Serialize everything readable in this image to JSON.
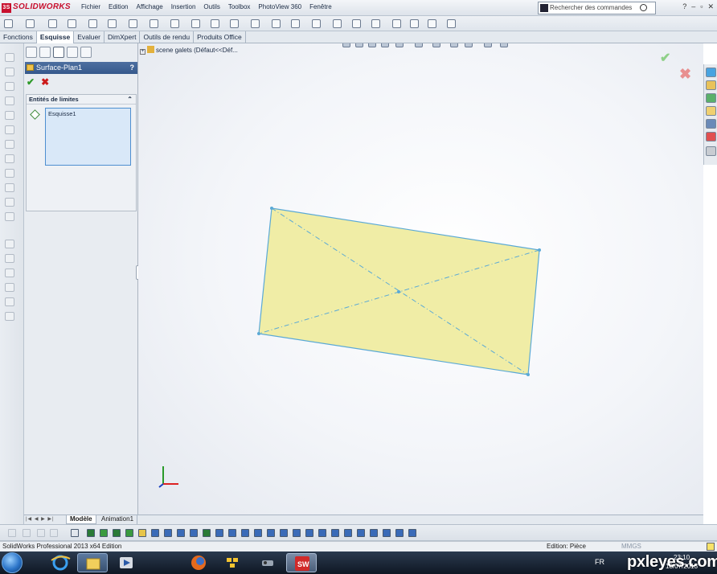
{
  "app": {
    "name": "SOLIDWORKS"
  },
  "menu": {
    "items": [
      "Fichier",
      "Edition",
      "Affichage",
      "Insertion",
      "Outils",
      "Toolbox",
      "PhotoView 360",
      "Fenêtre"
    ]
  },
  "search": {
    "placeholder": "Rechercher des commandes"
  },
  "command_tabs": [
    "Fonctions",
    "Esquisse",
    "Evaluer",
    "DimXpert",
    "Outils de rendu",
    "Produits Office"
  ],
  "active_command_tab": "Esquisse",
  "property_manager": {
    "title": "Surface-Plan1",
    "help_label": "?",
    "ok_label": "✔",
    "cancel_label": "✖",
    "group_title": "Entités de limites",
    "selection_items": [
      "Esquisse1"
    ]
  },
  "feature_tree": {
    "root_label": "scene galets  (Défaut<<Déf..."
  },
  "viewport": {
    "ok_label": "✔",
    "cancel_label": "✖",
    "sketch_fill": "#f0eda6",
    "sketch_stroke": "#5aa9d6",
    "triad_x_color": "#d22",
    "triad_y_color": "#2a9a2a",
    "triad_z_color": "#1a3fbf"
  },
  "bottom_tabs": {
    "model": "Modèle",
    "animation": "Animation1"
  },
  "status": {
    "product": "SolidWorks Professional 2013 x64 Edition",
    "mode": "Edition: Pièce",
    "units": "MMGS"
  },
  "taskbar": {
    "language": "FR",
    "time": "23:10",
    "date": "18/07/2013"
  },
  "watermark": "pxleyes.com",
  "colors": {
    "accent": "#36598c",
    "brand_red": "#c8102e"
  }
}
